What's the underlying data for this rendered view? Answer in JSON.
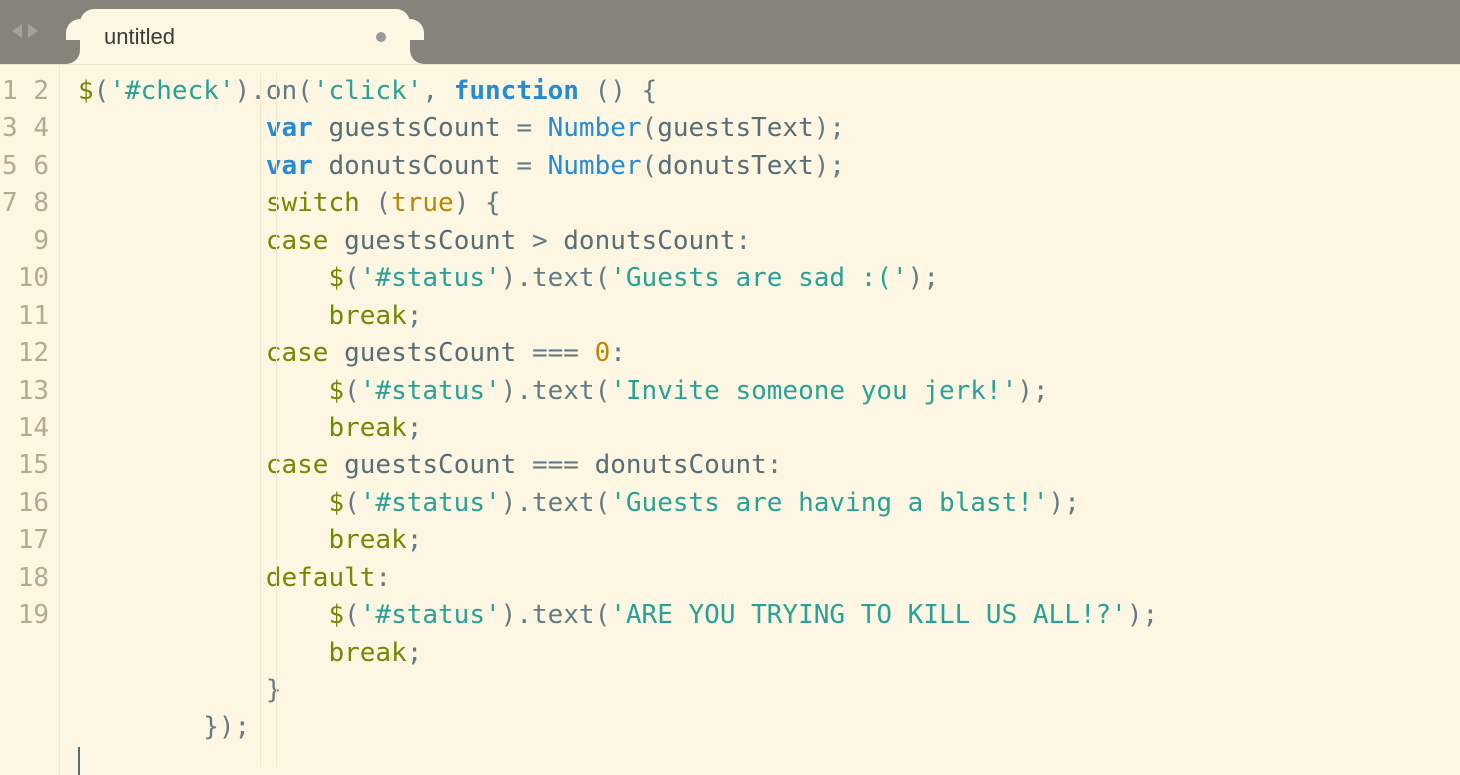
{
  "tab": {
    "title": "untitled",
    "dirty": true
  },
  "nav": {
    "back_disabled": true,
    "fwd_disabled": true
  },
  "editor": {
    "line_count": 19,
    "cursor_line": 19,
    "code_plain": "$('#check').on('click', function () {\n            var guestsCount = Number(guestsText);\n            var donutsCount = Number(donutsText);\n            switch (true) {\n            case guestsCount > donutsCount:\n                $('#status').text('Guests are sad :(');\n                break;\n            case guestsCount === 0:\n                $('#status').text('Invite someone you jerk!');\n                break;\n            case guestsCount === donutsCount:\n                $('#status').text('Guests are having a blast!');\n                break;\n            default:\n                $('#status').text('ARE YOU TRYING TO KILL US ALL!?');\n                break;\n            }\n        });",
    "tokens": [
      [
        [
          "$",
          "var"
        ],
        [
          "(",
          "punc"
        ],
        [
          "'#check'",
          "string"
        ],
        [
          ")",
          "punc"
        ],
        [
          ".",
          "punc"
        ],
        [
          "on",
          "method"
        ],
        [
          "(",
          "punc"
        ],
        [
          "'click'",
          "string"
        ],
        [
          ", ",
          "punc"
        ],
        [
          "function",
          "kw"
        ],
        [
          " ",
          "punc"
        ],
        [
          "() {",
          "punc"
        ]
      ],
      [
        [
          "            ",
          "punc"
        ],
        [
          "var",
          "kw"
        ],
        [
          " ",
          "punc"
        ],
        [
          "guestsCount",
          "ident"
        ],
        [
          " ",
          "punc"
        ],
        [
          "=",
          "punc"
        ],
        [
          " ",
          "punc"
        ],
        [
          "Number",
          "builtin"
        ],
        [
          "(",
          "punc"
        ],
        [
          "guestsText",
          "ident"
        ],
        [
          ");",
          "punc"
        ]
      ],
      [
        [
          "            ",
          "punc"
        ],
        [
          "var",
          "kw"
        ],
        [
          " ",
          "punc"
        ],
        [
          "donutsCount",
          "ident"
        ],
        [
          " ",
          "punc"
        ],
        [
          "=",
          "punc"
        ],
        [
          " ",
          "punc"
        ],
        [
          "Number",
          "builtin"
        ],
        [
          "(",
          "punc"
        ],
        [
          "donutsText",
          "ident"
        ],
        [
          ");",
          "punc"
        ]
      ],
      [
        [
          "            ",
          "punc"
        ],
        [
          "switch",
          "kw2"
        ],
        [
          " (",
          "punc"
        ],
        [
          "true",
          "bool"
        ],
        [
          ") {",
          "punc"
        ]
      ],
      [
        [
          "            ",
          "punc"
        ],
        [
          "case",
          "kw2"
        ],
        [
          " ",
          "punc"
        ],
        [
          "guestsCount",
          "ident"
        ],
        [
          " ",
          "punc"
        ],
        [
          ">",
          "punc"
        ],
        [
          " ",
          "punc"
        ],
        [
          "donutsCount",
          "ident"
        ],
        [
          ":",
          "punc"
        ]
      ],
      [
        [
          "                ",
          "punc"
        ],
        [
          "$",
          "var"
        ],
        [
          "(",
          "punc"
        ],
        [
          "'#status'",
          "string"
        ],
        [
          ")",
          "punc"
        ],
        [
          ".",
          "punc"
        ],
        [
          "text",
          "method"
        ],
        [
          "(",
          "punc"
        ],
        [
          "'Guests are sad :('",
          "string"
        ],
        [
          ");",
          "punc"
        ]
      ],
      [
        [
          "                ",
          "punc"
        ],
        [
          "break",
          "kw2"
        ],
        [
          ";",
          "punc"
        ]
      ],
      [
        [
          "            ",
          "punc"
        ],
        [
          "case",
          "kw2"
        ],
        [
          " ",
          "punc"
        ],
        [
          "guestsCount",
          "ident"
        ],
        [
          " ",
          "punc"
        ],
        [
          "===",
          "punc"
        ],
        [
          " ",
          "punc"
        ],
        [
          "0",
          "num"
        ],
        [
          ":",
          "punc"
        ]
      ],
      [
        [
          "                ",
          "punc"
        ],
        [
          "$",
          "var"
        ],
        [
          "(",
          "punc"
        ],
        [
          "'#status'",
          "string"
        ],
        [
          ")",
          "punc"
        ],
        [
          ".",
          "punc"
        ],
        [
          "text",
          "method"
        ],
        [
          "(",
          "punc"
        ],
        [
          "'Invite someone you jerk!'",
          "string"
        ],
        [
          ");",
          "punc"
        ]
      ],
      [
        [
          "                ",
          "punc"
        ],
        [
          "break",
          "kw2"
        ],
        [
          ";",
          "punc"
        ]
      ],
      [
        [
          "            ",
          "punc"
        ],
        [
          "case",
          "kw2"
        ],
        [
          " ",
          "punc"
        ],
        [
          "guestsCount",
          "ident"
        ],
        [
          " ",
          "punc"
        ],
        [
          "===",
          "punc"
        ],
        [
          " ",
          "punc"
        ],
        [
          "donutsCount",
          "ident"
        ],
        [
          ":",
          "punc"
        ]
      ],
      [
        [
          "                ",
          "punc"
        ],
        [
          "$",
          "var"
        ],
        [
          "(",
          "punc"
        ],
        [
          "'#status'",
          "string"
        ],
        [
          ")",
          "punc"
        ],
        [
          ".",
          "punc"
        ],
        [
          "text",
          "method"
        ],
        [
          "(",
          "punc"
        ],
        [
          "'Guests are having a blast!'",
          "string"
        ],
        [
          ");",
          "punc"
        ]
      ],
      [
        [
          "                ",
          "punc"
        ],
        [
          "break",
          "kw2"
        ],
        [
          ";",
          "punc"
        ]
      ],
      [
        [
          "            ",
          "punc"
        ],
        [
          "default",
          "kw2"
        ],
        [
          ":",
          "punc"
        ]
      ],
      [
        [
          "                ",
          "punc"
        ],
        [
          "$",
          "var"
        ],
        [
          "(",
          "punc"
        ],
        [
          "'#status'",
          "string"
        ],
        [
          ")",
          "punc"
        ],
        [
          ".",
          "punc"
        ],
        [
          "text",
          "method"
        ],
        [
          "(",
          "punc"
        ],
        [
          "'ARE YOU TRYING TO KILL US ALL!?'",
          "string"
        ],
        [
          ");",
          "punc"
        ]
      ],
      [
        [
          "                ",
          "punc"
        ],
        [
          "break",
          "kw2"
        ],
        [
          ";",
          "punc"
        ]
      ],
      [
        [
          "            }",
          "punc"
        ]
      ],
      [
        [
          "        });",
          "punc"
        ]
      ],
      [
        [
          "",
          "punc"
        ]
      ]
    ]
  },
  "colors": {
    "bg": "#fdf6e3",
    "titlebar": "#85837a",
    "string": "#2aa197",
    "keyword": "#268bd2",
    "keyword2": "#738900",
    "number": "#b58900",
    "text": "#657b83"
  }
}
